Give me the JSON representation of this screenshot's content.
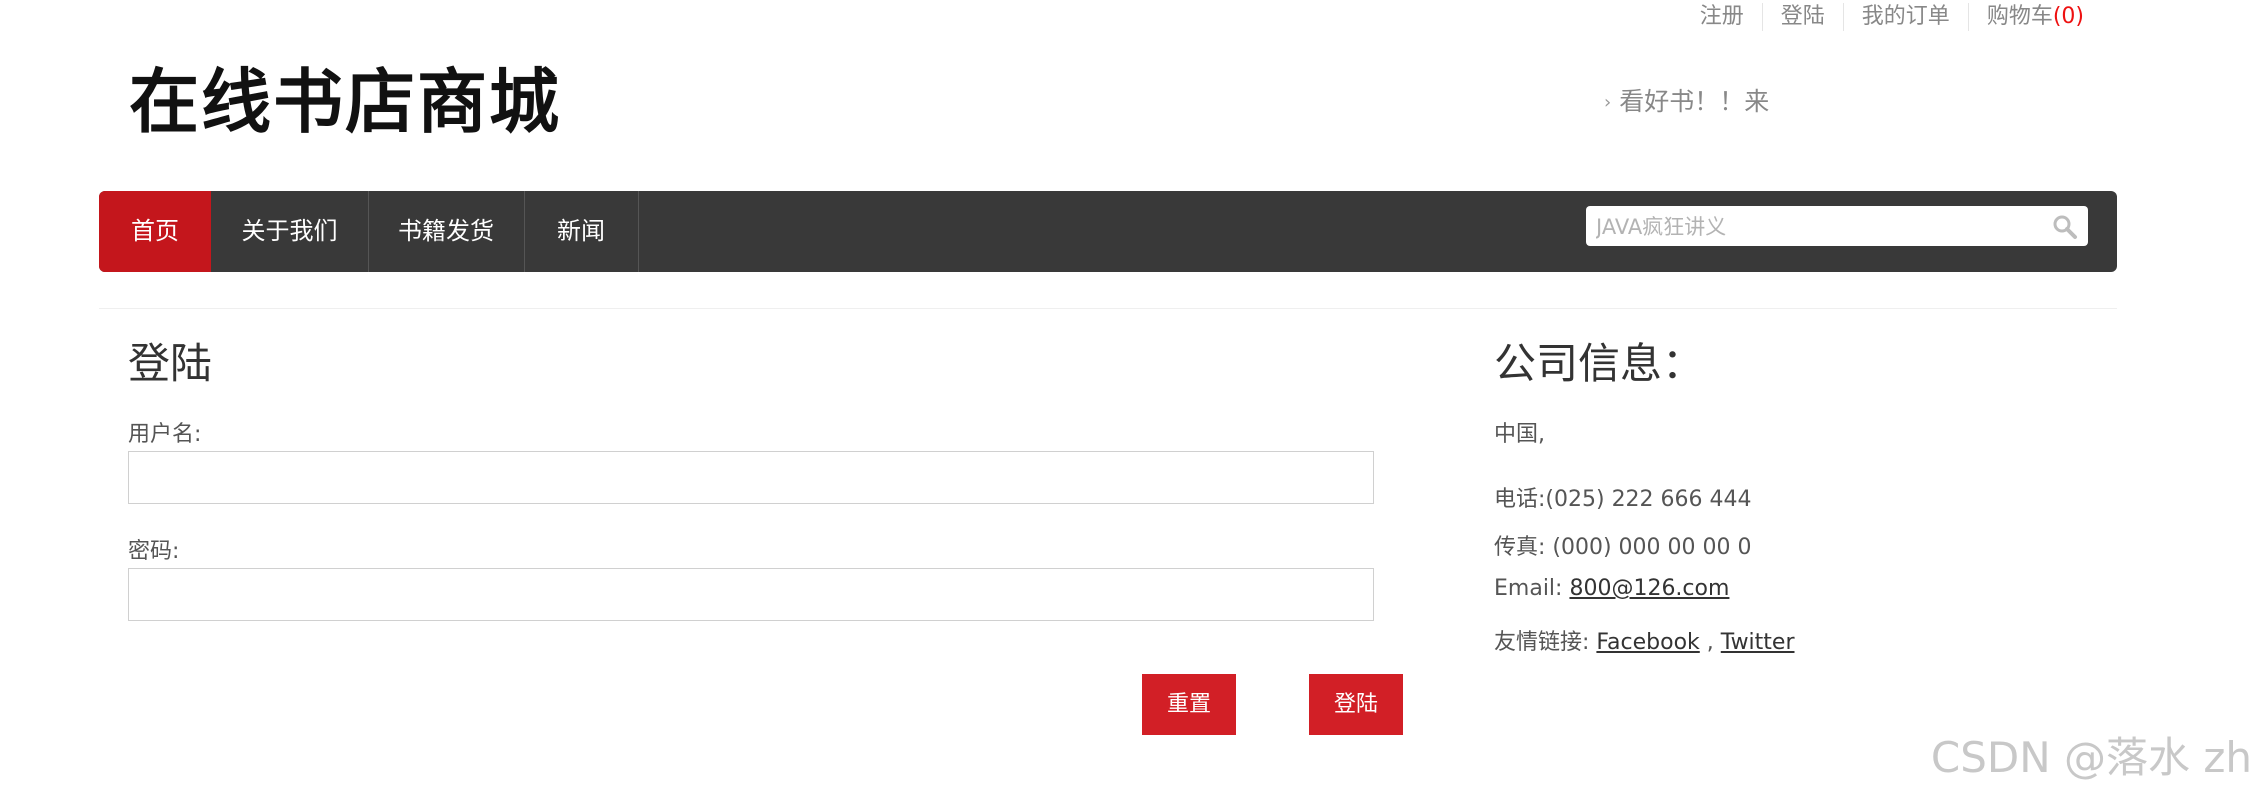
{
  "top_links": {
    "register": "注册",
    "login": "登陆",
    "orders": "我的订单",
    "cart": "购物车",
    "cart_count": "(0)"
  },
  "logo_text": "在线书店商城",
  "slogan": "看好书！！来",
  "nav": {
    "items": [
      "首页",
      "关于我们",
      "书籍发货",
      "新闻"
    ],
    "search_placeholder": "JAVA疯狂讲义"
  },
  "login": {
    "title": "登陆",
    "username_label": "用户名:",
    "password_label": "密码:",
    "reset_button": "重置",
    "submit_button": "登陆"
  },
  "company": {
    "title": "公司信息：",
    "country": "中国,",
    "phone": "电话:(025) 222 666 444",
    "fax": "传真: (000) 000 00 00 0",
    "email_label": "Email: ",
    "email": "800@126.com",
    "links_label": "友情链接: ",
    "link_facebook": "Facebook",
    "link_sep": " , ",
    "link_twitter": "Twitter"
  },
  "watermark": "CSDN @落水 zh"
}
